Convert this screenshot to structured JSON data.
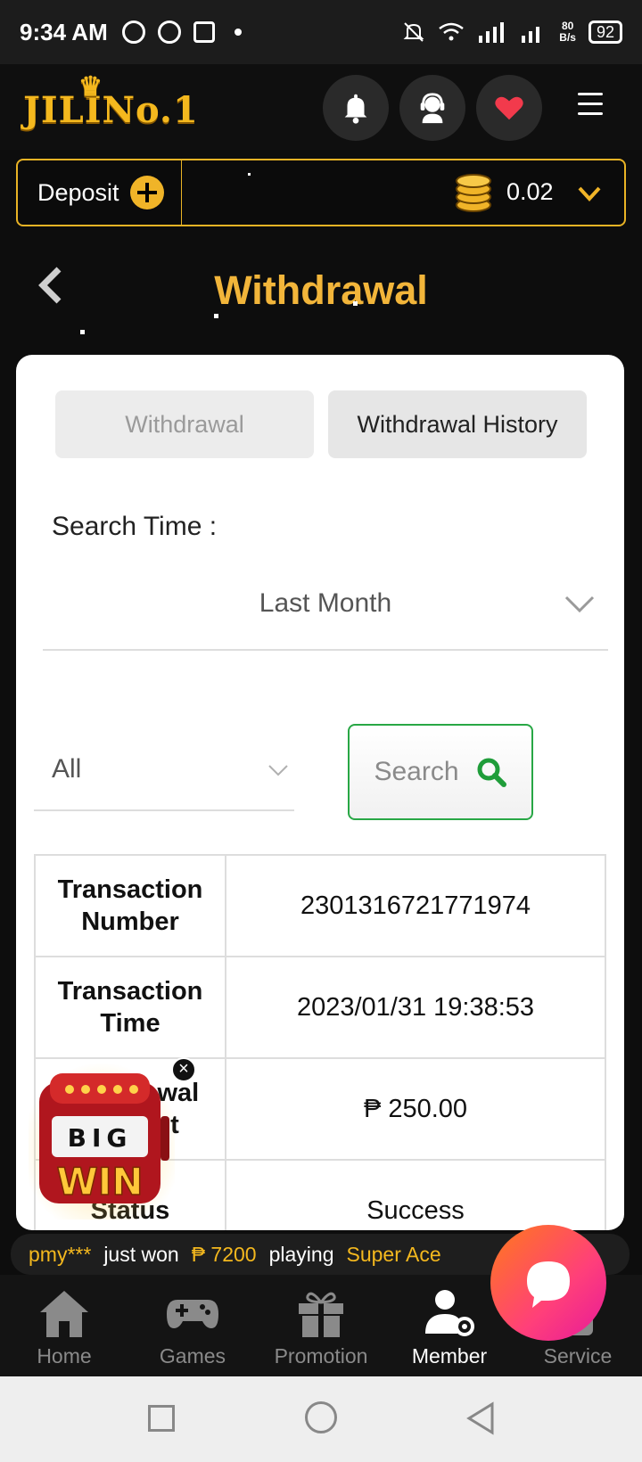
{
  "status_bar": {
    "time": "9:34 AM",
    "net_speed_value": "80",
    "net_speed_unit": "B/s",
    "battery": "92"
  },
  "header": {
    "logo_text": "JILINo.1"
  },
  "deposit": {
    "label": "Deposit",
    "balance": "0.02"
  },
  "page": {
    "title": "Withdrawal"
  },
  "tabs": [
    {
      "label": "Withdrawal",
      "active": false
    },
    {
      "label": "Withdrawal History",
      "active": true
    }
  ],
  "filters": {
    "search_time_label": "Search Time :",
    "time_range": "Last Month",
    "status": "All",
    "search_label": "Search"
  },
  "transaction": [
    {
      "key_line1": "Transaction",
      "key_line2": "Number",
      "value": "2301316721771974"
    },
    {
      "key_line1": "Transaction",
      "key_line2": "Time",
      "value": "2023/01/31 19:38:53"
    },
    {
      "key_line1": "Withdrawal",
      "key_line2": "Amount",
      "value": "₱ 250.00"
    },
    {
      "key_line1": "Status",
      "key_line2": "",
      "value": "Success"
    }
  ],
  "big_win": {
    "line1": "BIG",
    "line2": "WIN"
  },
  "ticker": {
    "user": "pmy***",
    "text1": "just won",
    "amount": "₱ 7200",
    "text2": "playing",
    "game": "Super Ace"
  },
  "nav": [
    {
      "label": "Home",
      "icon": "home-icon"
    },
    {
      "label": "Games",
      "icon": "gamepad-icon"
    },
    {
      "label": "Promotion",
      "icon": "gift-icon"
    },
    {
      "label": "Member",
      "icon": "member-icon"
    },
    {
      "label": "Service",
      "icon": "service-icon"
    }
  ],
  "colors": {
    "accent_gold": "#f2b53a",
    "search_green": "#28a745",
    "active_nav": "#ffffff"
  }
}
